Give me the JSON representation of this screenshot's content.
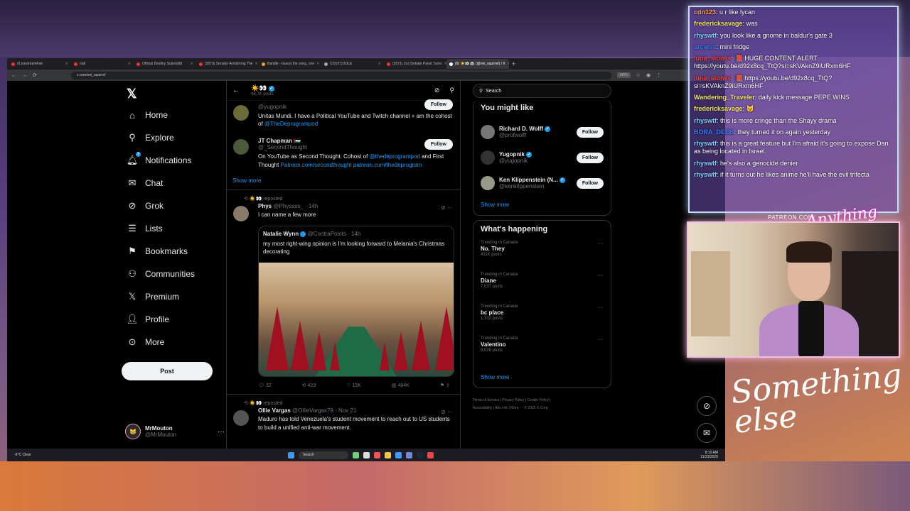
{
  "browser": {
    "tabs": [
      "r/LivestreamFail",
      "r/all",
      "Official Destiny Subreddit",
      "(3573) Senator Armstrong The",
      "Bandle - Guess the song, one",
      "COSTCOOLE",
      "(3571) 2v2 Debate Panel Turns",
      "(0) ☀️👀 🐼 (@oni_squirrel) / X"
    ],
    "url": "x.com/oni_squirrel",
    "zoom": "140%"
  },
  "nav": {
    "home": "Home",
    "explore": "Explore",
    "notifications": "Notifications",
    "notif_count": "9",
    "chat": "Chat",
    "grok": "Grok",
    "lists": "Lists",
    "bookmarks": "Bookmarks",
    "communities": "Communities",
    "premium": "Premium",
    "profile": "Profile",
    "more": "More",
    "post": "Post"
  },
  "account": {
    "name": "MrMouton",
    "handle": "@MrMouton"
  },
  "header": {
    "title": "☀️👀",
    "subtitle": "48.7K posts"
  },
  "cards": [
    {
      "handle": "@yugopnik",
      "bio": "Unitas Mundi. I have a Political YouTube and Twitch channel + am the cohost of ",
      "bio_link": "@TheDeprogrampod",
      "follow": "Follow"
    },
    {
      "name": "JT Chapman 🇵🇸",
      "handle": "@_SecondThought",
      "bio": "On YouTube as Second Thought. Cohost of ",
      "bio_link": "@thedeprogrampod",
      "bio_tail": " and First Thought ",
      "bio_link2": "Patreon.com/secondthought patreon.com/thedeprogram",
      "follow": "Follow"
    }
  ],
  "show_more_center": "Show more",
  "tweet1": {
    "repost": "☀️👀 reposted",
    "name": "Phys",
    "handle": "@Physsss_",
    "time": "· 14h",
    "text": "I can name a few more",
    "quote": {
      "name": "Natalie Wynn",
      "handle": "@ContraPoints · 14h",
      "text": "my most right-wing opinion is I'm looking forward to Melania's Christmas decorating"
    },
    "replies": "32",
    "reposts": "423",
    "likes": "15K",
    "views": "484K"
  },
  "tweet2": {
    "repost": "☀️👀 reposted",
    "name": "Ollie Vargas",
    "handle": "@OllieVargas79",
    "time": "· Nov 21",
    "text": "Maduro has told Venezuela's student movement to reach out to US students to build a unified anti-war movement."
  },
  "right": {
    "search_placeholder": "Search",
    "wtf_title": "You might like",
    "wtf": [
      {
        "name": "Richard D. Wolff",
        "handle": "@profwolff",
        "follow": "Follow"
      },
      {
        "name": "Yugopnik",
        "handle": "@yugopnik",
        "follow": "Follow"
      },
      {
        "name": "Ken Klippenstein (N...",
        "handle": "@kenklippenstein",
        "follow": "Follow"
      }
    ],
    "show_more": "Show more",
    "happening_title": "What's happening",
    "trends": [
      {
        "context": "Trending in Canada",
        "name": "No. They",
        "posts": "411K posts"
      },
      {
        "context": "Trending in Canada",
        "name": "Diane",
        "posts": "7,037 posts"
      },
      {
        "context": "Trending in Canada",
        "name": "bc place",
        "posts": "1,332 posts"
      },
      {
        "context": "Trending in Canada",
        "name": "Valentino",
        "posts": "9,028 posts"
      }
    ],
    "show_more2": "Show more",
    "footer1": "Terms of Service  |  Privacy Policy  |  Cookie Policy  |",
    "footer2": "Accessibility  |  Ads info  |  More ···  © 2025 X Corp."
  },
  "taskbar": {
    "weather": "-9°C Clear",
    "search": "Search",
    "time": "8:10 AM",
    "date": "11/23/2025"
  },
  "chat": [
    {
      "user": "cdn123",
      "color": "#ff9f43",
      "msg": " u r like lycan"
    },
    {
      "user": "fredericksavage",
      "color": "#f5e663",
      "msg": " was"
    },
    {
      "user": "rhyswtf",
      "color": "#7fd1ff",
      "msg": " you look like a gnome in baldur's gate 3"
    },
    {
      "user": "arcanis",
      "color": "#3a7bff",
      "msg": " mini fridge"
    },
    {
      "user": "luna_stonks",
      "color": "#ff3b3b",
      "msg": " 📕 HUGE CONTENT ALERT https://youtu.be/d92x8cq_TtQ?si=sKVAknZ9iURxm6HF"
    },
    {
      "user": "luna_stonks",
      "color": "#ff3b3b",
      "msg": " 📕 https://youtu.be/d92x8cq_TtQ?si=sKVAknZ9iURxm6HF"
    },
    {
      "user": "Wandering_Traveler",
      "color": "#f5e663",
      "msg": " daily kick message PEPE WINS"
    },
    {
      "user": "fredericksavage",
      "color": "#f5e663",
      "msg": " 🐱"
    },
    {
      "user": "rhyswtf",
      "color": "#7fd1ff",
      "msg": " this is more cringe than the Shayy drama"
    },
    {
      "user": "BORA_DEEB",
      "color": "#3a7bff",
      "msg": " they turned it on again yesterday"
    },
    {
      "user": "rhyswtf",
      "color": "#7fd1ff",
      "msg": " this is a great feature but I'm afraid it's going to expose Dan as being located in Israel."
    },
    {
      "user": "rhyswtf",
      "color": "#7fd1ff",
      "msg": " he's also a genocide denier"
    },
    {
      "user": "rhyswtf",
      "color": "#7fd1ff",
      "msg": " if it turns out he likes anime he'll have the evil trifecta"
    }
  ],
  "overlay": {
    "patreon": "PATREON.COM/",
    "brand_small": "Anything else",
    "brand_big": "Something else"
  }
}
